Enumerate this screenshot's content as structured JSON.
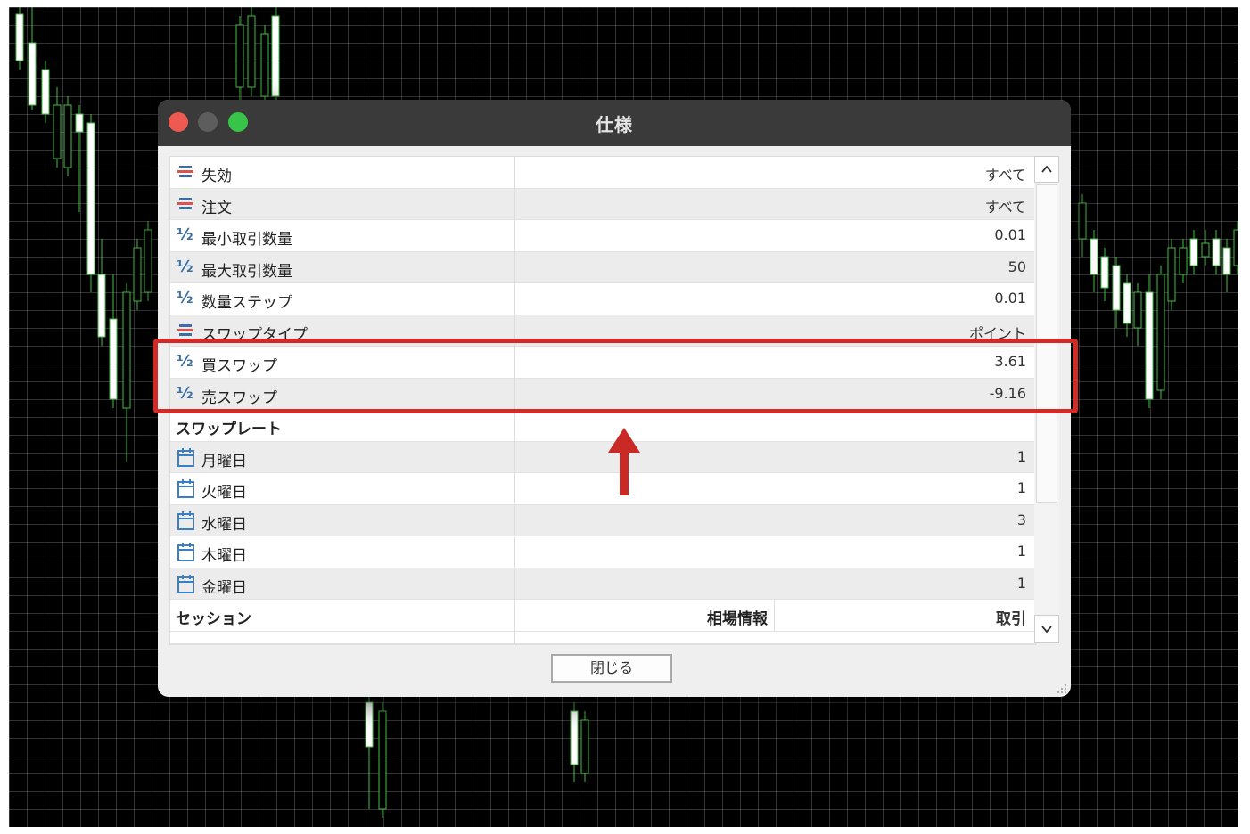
{
  "window": {
    "title": "仕様",
    "close_button_label": "閉じる"
  },
  "rows": [
    {
      "label": "失効",
      "value": "すべて",
      "icon": "stack-icon"
    },
    {
      "label": "注文",
      "value": "すべて",
      "icon": "stack-icon"
    },
    {
      "label": "最小取引数量",
      "value": "0.01",
      "icon": "one-half-icon"
    },
    {
      "label": "最大取引数量",
      "value": "50",
      "icon": "one-half-icon"
    },
    {
      "label": "数量ステップ",
      "value": "0.01",
      "icon": "one-half-icon"
    },
    {
      "label": "スワップタイプ",
      "value": "ポイント",
      "icon": "stack-icon"
    },
    {
      "label": "買スワップ",
      "value": "3.61",
      "icon": "one-half-icon"
    },
    {
      "label": "売スワップ",
      "value": "-9.16",
      "icon": "one-half-icon"
    }
  ],
  "swap_rate_section": {
    "title": "スワップレート",
    "days": [
      {
        "label": "月曜日",
        "value": "1",
        "icon": "calendar-icon"
      },
      {
        "label": "火曜日",
        "value": "1",
        "icon": "calendar-icon"
      },
      {
        "label": "水曜日",
        "value": "3",
        "icon": "calendar-icon"
      },
      {
        "label": "木曜日",
        "value": "1",
        "icon": "calendar-icon"
      },
      {
        "label": "金曜日",
        "value": "1",
        "icon": "calendar-icon"
      }
    ]
  },
  "session_section": {
    "title": "セッション",
    "col_quotes": "相場情報",
    "col_trade": "取引"
  },
  "colors": {
    "highlight": "#d32a26",
    "traffic_close": "#ee5a52",
    "traffic_max": "#38c449",
    "stack_icon_blue": "#3a6ea5",
    "stack_icon_red": "#d9534f"
  }
}
